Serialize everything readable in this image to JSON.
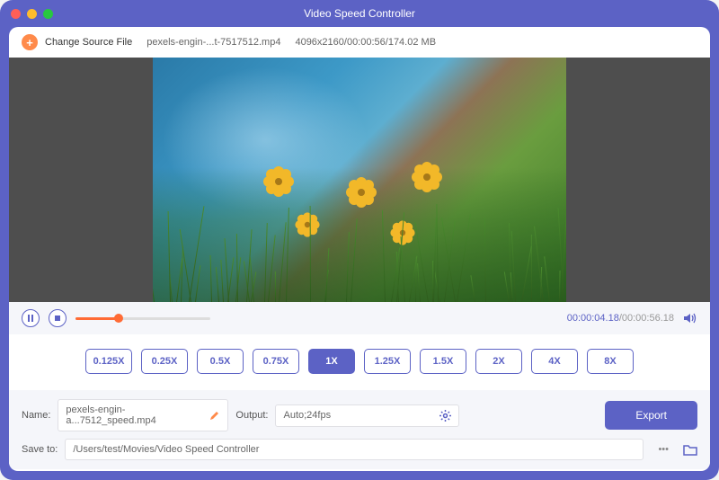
{
  "window": {
    "title": "Video Speed Controller"
  },
  "source": {
    "change_label": "Change Source File",
    "filename": "pexels-engin-...t-7517512.mp4",
    "metadata": "4096x2160/00:00:56/174.02 MB"
  },
  "playback": {
    "time_current": "00:00:04.18",
    "time_total": "/00:00:56.18"
  },
  "speeds": {
    "options": [
      "0.125X",
      "0.25X",
      "0.5X",
      "0.75X",
      "1X",
      "1.25X",
      "1.5X",
      "2X",
      "4X",
      "8X"
    ],
    "active_index": 4
  },
  "output": {
    "name_label": "Name:",
    "name_value": "pexels-engin-a...7512_speed.mp4",
    "output_label": "Output:",
    "output_value": "Auto;24fps",
    "saveto_label": "Save to:",
    "saveto_value": "/Users/test/Movies/Video Speed Controller",
    "export_label": "Export"
  }
}
